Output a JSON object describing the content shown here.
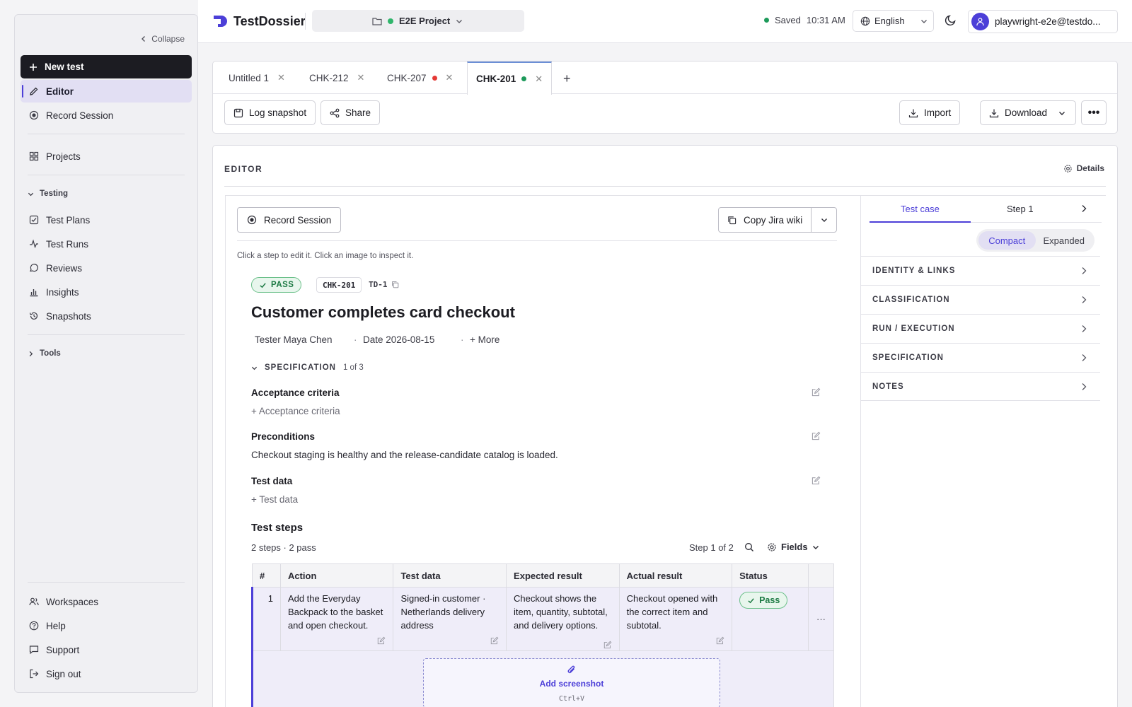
{
  "sidebar": {
    "collapse_label": "Collapse",
    "new_test_label": "New test",
    "items_top": [
      {
        "label": "Editor"
      },
      {
        "label": "Record Session"
      },
      {
        "label": "Projects"
      }
    ],
    "testing_heading": "Testing",
    "testing_items": [
      {
        "label": "Test Plans"
      },
      {
        "label": "Test Runs"
      },
      {
        "label": "Reviews"
      },
      {
        "label": "Insights"
      },
      {
        "label": "Snapshots"
      }
    ],
    "tools_heading": "Tools",
    "bottom_items": [
      {
        "label": "Workspaces"
      },
      {
        "label": "Help"
      },
      {
        "label": "Support"
      },
      {
        "label": "Sign out"
      }
    ]
  },
  "topbar": {
    "app_name": "TestDossier",
    "project": "E2E Project",
    "saved_label": "Saved",
    "saved_time": "10:31 AM",
    "language": "English",
    "user": "playwright-e2e@testdo..."
  },
  "tabs": [
    {
      "label": "Untitled 1",
      "dot": null
    },
    {
      "label": "CHK-212",
      "dot": null
    },
    {
      "label": "CHK-207",
      "dot": "#e53935"
    },
    {
      "label": "CHK-201",
      "dot": "#1d9a5a"
    }
  ],
  "toolbar": {
    "log_snapshot": "Log snapshot",
    "share": "Share",
    "import": "Import",
    "download": "Download"
  },
  "editor": {
    "heading": "EDITOR",
    "details": "Details",
    "record_session": "Record Session",
    "copy_jira": "Copy Jira wiki",
    "hint": "Click a step to edit it. Click an image to inspect it.",
    "status": "PASS",
    "case_id": "CHK-201",
    "td_id": "TD-1",
    "title": "Customer completes card checkout",
    "tester": "Tester Maya Chen",
    "date": "Date 2026-08-15",
    "more": "+ More",
    "spec_heading": "SPECIFICATION",
    "spec_count": "1 of 3",
    "acceptance_label": "Acceptance criteria",
    "acceptance_add": "+ Acceptance criteria",
    "preconditions_label": "Preconditions",
    "preconditions_value": "Checkout staging is healthy and the release-candidate catalog is loaded.",
    "testdata_label": "Test data",
    "testdata_add": "+ Test data",
    "steps_heading": "Test steps",
    "steps_summary": "2 steps · 2 pass",
    "step_of": "Step 1 of 2",
    "fields": "Fields",
    "columns": [
      "#",
      "Action",
      "Test data",
      "Expected result",
      "Actual result",
      "Status"
    ],
    "rows": [
      {
        "num": "1",
        "action": "Add the Everyday Backpack to the basket and open checkout.",
        "test_data": "Signed-in customer · Netherlands delivery address",
        "expected": "Checkout shows the item, quantity, subtotal, and delivery options.",
        "actual": "Checkout opened with the correct item and subtotal.",
        "status": "Pass"
      }
    ],
    "add_screenshot": "Add screenshot",
    "screenshot_shortcut": "Ctrl+V"
  },
  "right_panel": {
    "tab_case": "Test case",
    "tab_step": "Step 1",
    "compact": "Compact",
    "expanded": "Expanded",
    "sections": [
      "IDENTITY & LINKS",
      "CLASSIFICATION",
      "RUN / EXECUTION",
      "SPECIFICATION",
      "NOTES"
    ]
  },
  "colors": {
    "accent": "#4c3fd8",
    "pass_green": "#1d7a44",
    "project_dot": "#2fb56b",
    "saved_dot": "#1d9a5a"
  }
}
